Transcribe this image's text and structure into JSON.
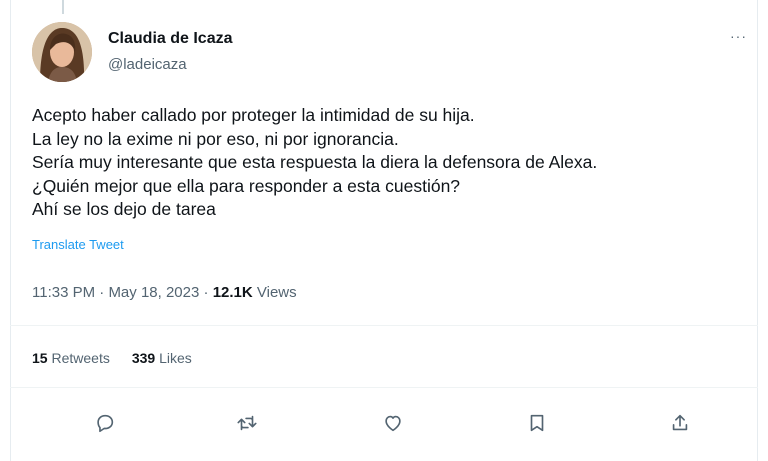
{
  "author": {
    "name": "Claudia de Icaza",
    "handle": "@ladeicaza"
  },
  "tweet": {
    "lines": [
      "Acepto haber callado por proteger la intimidad de su hija.",
      "La ley no la exime ni por eso, ni por ignorancia.",
      "Sería muy interesante que esta respuesta la diera la defensora de Alexa.",
      "¿Quién mejor que ella para responder a esta cuestión?",
      "Ahí se los dejo de tarea"
    ],
    "translate_label": "Translate Tweet"
  },
  "meta": {
    "time": "11:33 PM",
    "separator": " · ",
    "date": "May 18, 2023",
    "views_count": "12.1K",
    "views_label": "Views"
  },
  "stats": {
    "retweets_count": "15",
    "retweets_label": "Retweets",
    "likes_count": "339",
    "likes_label": "Likes"
  },
  "more_label": "···",
  "icons": {
    "reply": "reply-icon",
    "retweet": "retweet-icon",
    "like": "heart-icon",
    "bookmark": "bookmark-icon",
    "share": "share-icon"
  },
  "colors": {
    "link": "#1d9bf0",
    "secondary_text": "#536471",
    "primary_text": "#0f1419"
  }
}
